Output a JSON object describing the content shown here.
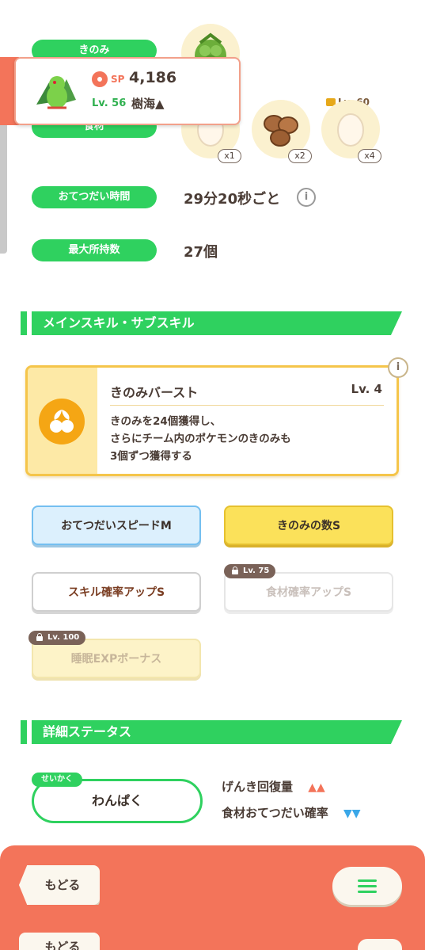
{
  "pokemon": {
    "sp_label": "SP",
    "sp_value": "4,186",
    "level": "Lv. 56",
    "area": "樹海▲"
  },
  "stats": {
    "berry_label": "きのみ",
    "ingredient_label": "食材",
    "help_time_label": "おてつだい時間",
    "help_time_value": "29分20秒ごと",
    "max_carry_label": "最大所持数",
    "max_carry_value": "27個"
  },
  "ingredients": [
    {
      "name": "egg",
      "count": "x1"
    },
    {
      "name": "soybeans",
      "count": "x2"
    },
    {
      "name": "egg",
      "count": "x4",
      "lock_level": "Lv. 60"
    }
  ],
  "sections": {
    "skills": "メインスキル・サブスキル",
    "details": "詳細ステータス"
  },
  "main_skill": {
    "name": "きのみバースト",
    "level": "Lv. 4",
    "description_lines": [
      "きのみを24個獲得し、",
      "さらにチーム内のポケモンのきのみも",
      "3個ずつ獲得する"
    ]
  },
  "sub_skills": [
    {
      "label": "おてつだいスピードM",
      "style": "blue"
    },
    {
      "label": "きのみの数S",
      "style": "yellow"
    },
    {
      "label": "スキル確率アップS",
      "style": "white"
    },
    {
      "label": "食材確率アップS",
      "style": "disabled",
      "lock": "Lv. 75"
    },
    {
      "label": "睡眠EXPボーナス",
      "style": "disabled-yellow",
      "lock": "Lv. 100"
    }
  ],
  "nature": {
    "tag": "せいかく",
    "value": "わんぱく",
    "effects": [
      {
        "label": "げんき回復量",
        "arrows": "▲▲",
        "color": "#f3745a"
      },
      {
        "label": "食材おてつだい確率",
        "arrows": "▼▼",
        "color": "#3aa7e8"
      }
    ]
  },
  "nav": {
    "back": "もどる",
    "back_shadow": "もどる"
  },
  "colors": {
    "accent_green": "#2fd15f",
    "bar_orange": "#f3745a",
    "skill_gold": "#f5c54a"
  }
}
